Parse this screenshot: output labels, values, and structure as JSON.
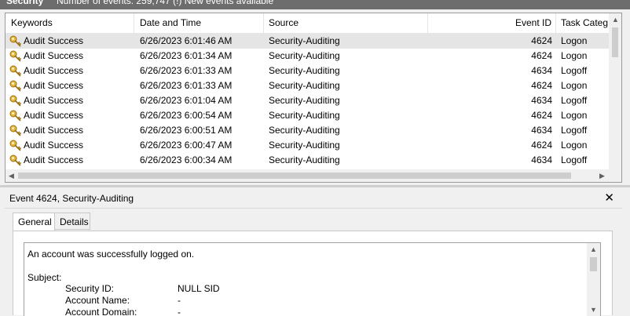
{
  "header": {
    "title": "Security",
    "subtitle": "Number of events: 259,747 (!) New events available"
  },
  "columns": [
    "Keywords",
    "Date and Time",
    "Source",
    "Event ID",
    "Task Categ"
  ],
  "rows": [
    {
      "keyword": "Audit Success",
      "datetime": "6/26/2023 6:01:46 AM",
      "source": "Security-Auditing",
      "event_id": "4624",
      "task": "Logon"
    },
    {
      "keyword": "Audit Success",
      "datetime": "6/26/2023 6:01:34 AM",
      "source": "Security-Auditing",
      "event_id": "4624",
      "task": "Logon"
    },
    {
      "keyword": "Audit Success",
      "datetime": "6/26/2023 6:01:33 AM",
      "source": "Security-Auditing",
      "event_id": "4634",
      "task": "Logoff"
    },
    {
      "keyword": "Audit Success",
      "datetime": "6/26/2023 6:01:33 AM",
      "source": "Security-Auditing",
      "event_id": "4624",
      "task": "Logon"
    },
    {
      "keyword": "Audit Success",
      "datetime": "6/26/2023 6:01:04 AM",
      "source": "Security-Auditing",
      "event_id": "4634",
      "task": "Logoff"
    },
    {
      "keyword": "Audit Success",
      "datetime": "6/26/2023 6:00:54 AM",
      "source": "Security-Auditing",
      "event_id": "4624",
      "task": "Logon"
    },
    {
      "keyword": "Audit Success",
      "datetime": "6/26/2023 6:00:51 AM",
      "source": "Security-Auditing",
      "event_id": "4634",
      "task": "Logoff"
    },
    {
      "keyword": "Audit Success",
      "datetime": "6/26/2023 6:00:47 AM",
      "source": "Security-Auditing",
      "event_id": "4624",
      "task": "Logon"
    },
    {
      "keyword": "Audit Success",
      "datetime": "6/26/2023 6:00:34 AM",
      "source": "Security-Auditing",
      "event_id": "4634",
      "task": "Logoff"
    }
  ],
  "detail": {
    "title": "Event 4624, Security-Auditing",
    "close_label": "✕",
    "tabs": [
      "General",
      "Details"
    ],
    "message": "An account was successfully logged on.",
    "subject_label": "Subject:",
    "fields": [
      {
        "label": "Security ID:",
        "value": "NULL SID"
      },
      {
        "label": "Account Name:",
        "value": "-"
      },
      {
        "label": "Account Domain:",
        "value": "-"
      }
    ]
  },
  "icons": {
    "row_icon": "key-icon"
  },
  "colors": {
    "selected_row": "#e5e5e5",
    "key_gold": "#c8961e"
  }
}
